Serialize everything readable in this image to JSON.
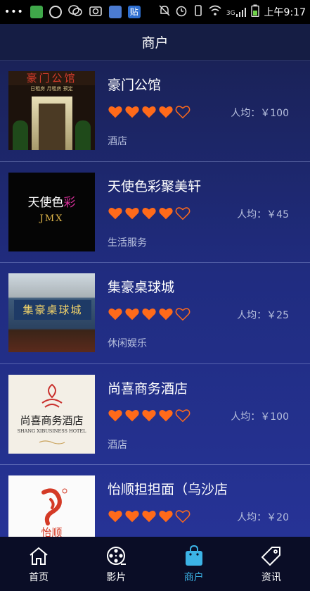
{
  "status_bar": {
    "left_icons": [
      "more-icon",
      "wechat-green-icon",
      "gps-icon",
      "wechat-icon",
      "camera-icon",
      "cloud-icon",
      "tieba-icon"
    ],
    "tieba_label": "贴",
    "right_icons": [
      "mute-icon",
      "alarm-icon",
      "vibrate-icon",
      "wifi-icon",
      "signal-icon",
      "battery-icon"
    ],
    "network": "3G",
    "time": "上午9:17"
  },
  "header": {
    "title": "商户"
  },
  "merchants": [
    {
      "name": "豪门公馆",
      "rating": 4,
      "max_rating": 5,
      "price": "人均：￥100",
      "category": "酒店",
      "thumb_text": "豪门公馆",
      "thumb_sub": "日租房  月租房  预定"
    },
    {
      "name": "天使色彩聚美轩",
      "rating": 4,
      "max_rating": 5,
      "price": "人均：￥45",
      "category": "生活服务",
      "thumb_text_a": "天使色",
      "thumb_text_b": "彩",
      "thumb_sub": "JMX"
    },
    {
      "name": "集豪桌球城",
      "rating": 4,
      "max_rating": 5,
      "price": "人均：￥25",
      "category": "休闲娱乐",
      "thumb_text": "集豪桌球城"
    },
    {
      "name": "尚喜商务酒店",
      "rating": 4,
      "max_rating": 5,
      "price": "人均：￥100",
      "category": "酒店",
      "thumb_text": "尚喜商务酒店",
      "thumb_sub": "SHANG XIBUSINESS HOTEL"
    },
    {
      "name": "怡顺担担面（乌沙店",
      "rating": 4,
      "max_rating": 5,
      "price": "人均：￥20",
      "category": "",
      "thumb_text": "怡顺"
    }
  ],
  "colors": {
    "heart": "#ff6a1a",
    "accent": "#3cb3e6"
  },
  "tabs": [
    {
      "label": "首页",
      "icon": "home-icon",
      "active": false
    },
    {
      "label": "影片",
      "icon": "film-reel-icon",
      "active": false
    },
    {
      "label": "商户",
      "icon": "shopping-bag-icon",
      "active": true
    },
    {
      "label": "资讯",
      "icon": "tag-icon",
      "active": false
    }
  ]
}
